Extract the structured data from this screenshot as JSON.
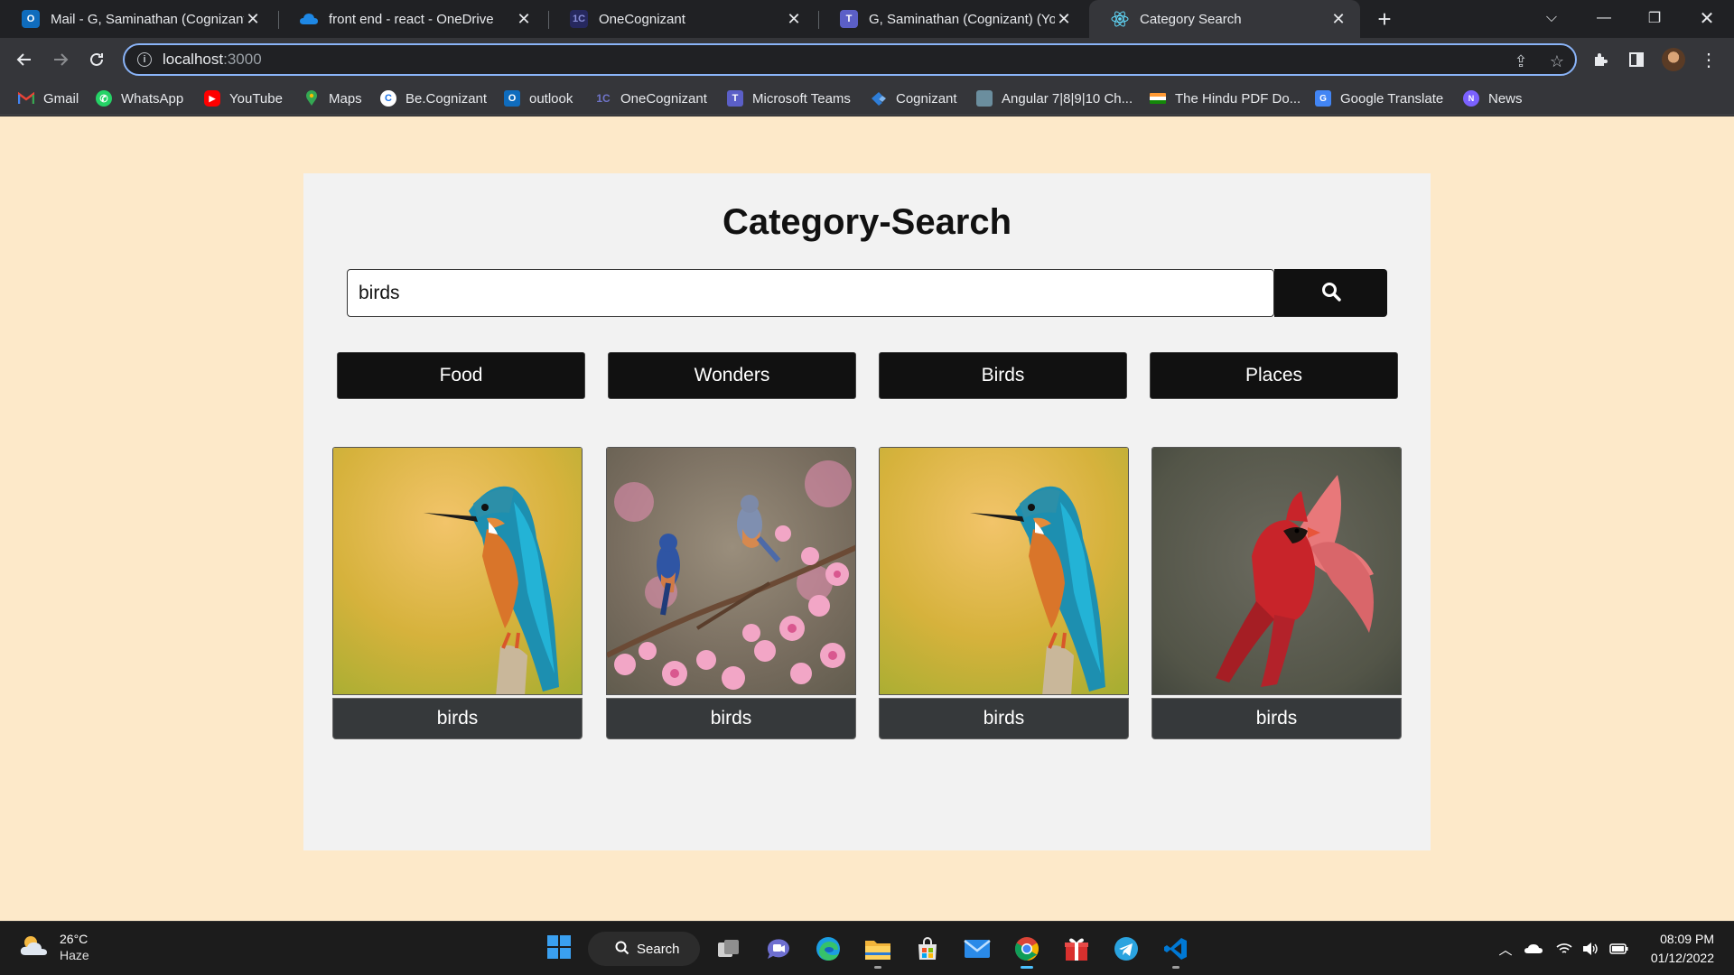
{
  "browser": {
    "tabs": [
      {
        "title": "Mail - G, Saminathan (Cognizant)",
        "icon": "outlook-icon",
        "color": "#0f6cbd"
      },
      {
        "title": "front end - react - OneDrive",
        "icon": "onedrive-icon",
        "color": "#1e88e5"
      },
      {
        "title": "OneCognizant",
        "icon": "onecognizant-icon",
        "color": "#3b3f8f"
      },
      {
        "title": "G, Saminathan (Cognizant) (You)",
        "icon": "teams-icon",
        "color": "#5b5fc7"
      },
      {
        "title": "Category Search",
        "icon": "react-icon",
        "color": "#61dafb",
        "active": true
      }
    ],
    "address": {
      "host": "localhost",
      "port": ":3000"
    },
    "bookmarks": [
      {
        "label": "Gmail",
        "icon": "gmail-icon",
        "color": "#ea4335"
      },
      {
        "label": "WhatsApp",
        "icon": "whatsapp-icon",
        "color": "#25d366"
      },
      {
        "label": "YouTube",
        "icon": "youtube-icon",
        "color": "#ff0000"
      },
      {
        "label": "Maps",
        "icon": "maps-icon",
        "color": "#34a853"
      },
      {
        "label": "Be.Cognizant",
        "icon": "becognizant-icon",
        "color": "#1a73e8"
      },
      {
        "label": "outlook",
        "icon": "outlook-icon",
        "color": "#0f6cbd"
      },
      {
        "label": "OneCognizant",
        "icon": "onecognizant-icon",
        "color": "#3b3f8f"
      },
      {
        "label": "Microsoft Teams",
        "icon": "teams-icon",
        "color": "#5b5fc7"
      },
      {
        "label": "Cognizant",
        "icon": "cognizant-icon",
        "color": "#2e7dd7"
      },
      {
        "label": "Angular 7|8|9|10 Ch...",
        "icon": "angular-icon",
        "color": "#6b8e9e"
      },
      {
        "label": "The Hindu PDF Do...",
        "icon": "india-flag-icon",
        "color": "#ff9933"
      },
      {
        "label": "Google Translate",
        "icon": "translate-icon",
        "color": "#4285f4"
      },
      {
        "label": "News",
        "icon": "news-icon",
        "color": "#7b61ff"
      }
    ]
  },
  "page": {
    "title": "Category-Search",
    "search": {
      "value": "birds",
      "button_icon": "search-icon"
    },
    "categories": [
      "Food",
      "Wonders",
      "Birds",
      "Places"
    ],
    "results": [
      {
        "caption": "birds",
        "image": "kingfisher"
      },
      {
        "caption": "birds",
        "image": "bluebirds-blossoms"
      },
      {
        "caption": "birds",
        "image": "kingfisher"
      },
      {
        "caption": "birds",
        "image": "cardinal"
      }
    ],
    "background_color": "#fde9c9",
    "card_color": "#f2f2f2"
  },
  "taskbar": {
    "weather": {
      "temp": "26°C",
      "desc": "Haze"
    },
    "search_label": "Search",
    "clock": {
      "time": "08:09 PM",
      "date": "01/12/2022"
    }
  }
}
